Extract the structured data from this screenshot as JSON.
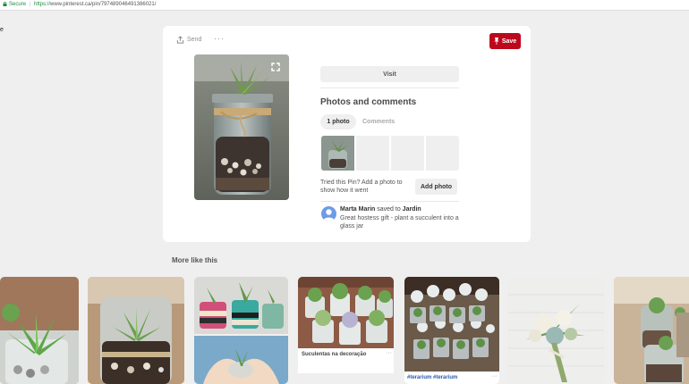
{
  "address_bar": {
    "secure_label": "Secure",
    "url_scheme": "https://",
    "url_rest": "www.pinterest.ca/pin/797489046491386021/"
  },
  "left_fragment": "e",
  "pin": {
    "send_label": "Send",
    "more_label": "···",
    "save_label": "Save",
    "visit_label": "Visit",
    "photos_title": "Photos and comments",
    "tab_photos": "1 photo",
    "tab_comments": "Comments",
    "tried_text": "Tried this Pin? Add a photo to show how it went",
    "add_photo_label": "Add photo",
    "saver_name": "Marta Marin",
    "saved_to_text": "saved to",
    "board_name": "Jardin",
    "caption": "Great hostess gift - plant a succulent into a glass jar"
  },
  "more_like_this": {
    "title": "More like this",
    "tile4_caption": "Suculentas na decoração",
    "tile4_more": "···",
    "tile5_tags": "#terarium #terarium",
    "tile5_more": "···"
  },
  "colors": {
    "save_red": "#bd081c",
    "background": "#efefef",
    "tag_blue": "#2a59b2"
  }
}
